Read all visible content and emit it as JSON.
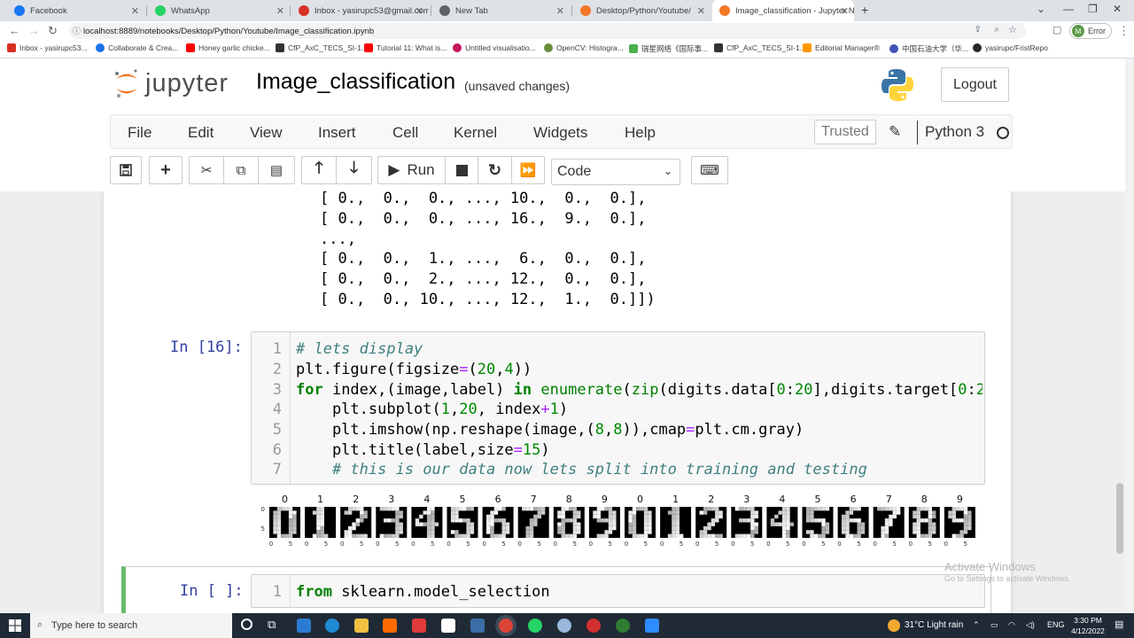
{
  "browser": {
    "tabs": [
      {
        "title": "Facebook",
        "color": "#1877f2"
      },
      {
        "title": "WhatsApp",
        "color": "#25d366"
      },
      {
        "title": "Inbox - yasirupc53@gmail.com -",
        "color": "#d93025"
      },
      {
        "title": "New Tab",
        "color": "#5f6368"
      },
      {
        "title": "Desktop/Python/Youtube/",
        "color": "#f37726"
      },
      {
        "title": "Image_classification - Jupyter No",
        "color": "#f37726"
      }
    ],
    "url": "localhost:8889/notebooks/Desktop/Python/Youtube/Image_classification.ipynb",
    "profile_initial": "M",
    "profile_status": "Error",
    "bookmarks": [
      {
        "label": "Inbox - yasirupc53...",
        "color": "#d93025"
      },
      {
        "label": "Collaborate & Crea...",
        "color": "#1a73e8"
      },
      {
        "label": "Honey garlic chicke...",
        "color": "#ff0000"
      },
      {
        "label": "CfP_AxC_TECS_SI-1...",
        "color": "#333333"
      },
      {
        "label": "Tutorial 11: What is...",
        "color": "#ff0000"
      },
      {
        "label": "Untitled visualisatio...",
        "color": "#c2185b"
      },
      {
        "label": "OpenCV: Histogra...",
        "color": "#6a8b3a"
      },
      {
        "label": "瑞星网络《国际事...",
        "color": "#4caf50"
      },
      {
        "label": "CfP_AxC_TECS_SI-1...",
        "color": "#333333"
      },
      {
        "label": "Editorial Manager®",
        "color": "#ff9800"
      },
      {
        "label": "中国石油大学（华...",
        "color": "#3f51b5"
      },
      {
        "label": "yasirupc/FristRepo",
        "color": "#24292e"
      }
    ]
  },
  "jupyter": {
    "logo_text": "jupyter",
    "notebook_title": "Image_classification",
    "unsaved": "(unsaved changes)",
    "logout": "Logout",
    "menu": [
      "File",
      "Edit",
      "View",
      "Insert",
      "Cell",
      "Kernel",
      "Widgets",
      "Help"
    ],
    "trusted": "Trusted",
    "kernel": "Python 3",
    "run_label": "Run",
    "cell_type": "Code"
  },
  "output_prev": [
    "[ 0.,  0.,  0., ..., 10.,  0.,  0.],",
    "[ 0.,  0.,  0., ..., 16.,  9.,  0.],",
    "...,",
    "[ 0.,  0.,  1., ...,  6.,  0.,  0.],",
    "[ 0.,  0.,  2., ..., 12.,  0.,  0.],",
    "[ 0.,  0., 10., ..., 12.,  1.,  0.]])"
  ],
  "cell16": {
    "prompt": "In [16]:",
    "line_numbers": [
      "1",
      "2",
      "3",
      "4",
      "5",
      "6",
      "7"
    ]
  },
  "digits_plot": {
    "labels": [
      "0",
      "1",
      "2",
      "3",
      "4",
      "5",
      "6",
      "7",
      "8",
      "9",
      "0",
      "1",
      "2",
      "3",
      "4",
      "5",
      "6",
      "7",
      "8",
      "9"
    ],
    "y_ticks": [
      "0",
      "5"
    ],
    "x_ticks": [
      "0",
      "5"
    ]
  },
  "cell_next": {
    "prompt": "In [ ]:",
    "line_number": "1"
  },
  "activation": {
    "title": "Activate Windows",
    "subtitle": "Go to Settings to activate Windows."
  },
  "taskbar": {
    "search_placeholder": "Type here to search",
    "weather": "31°C  Light rain",
    "lang": "ENG",
    "time": "3:30 PM",
    "date": "4/12/2022"
  }
}
